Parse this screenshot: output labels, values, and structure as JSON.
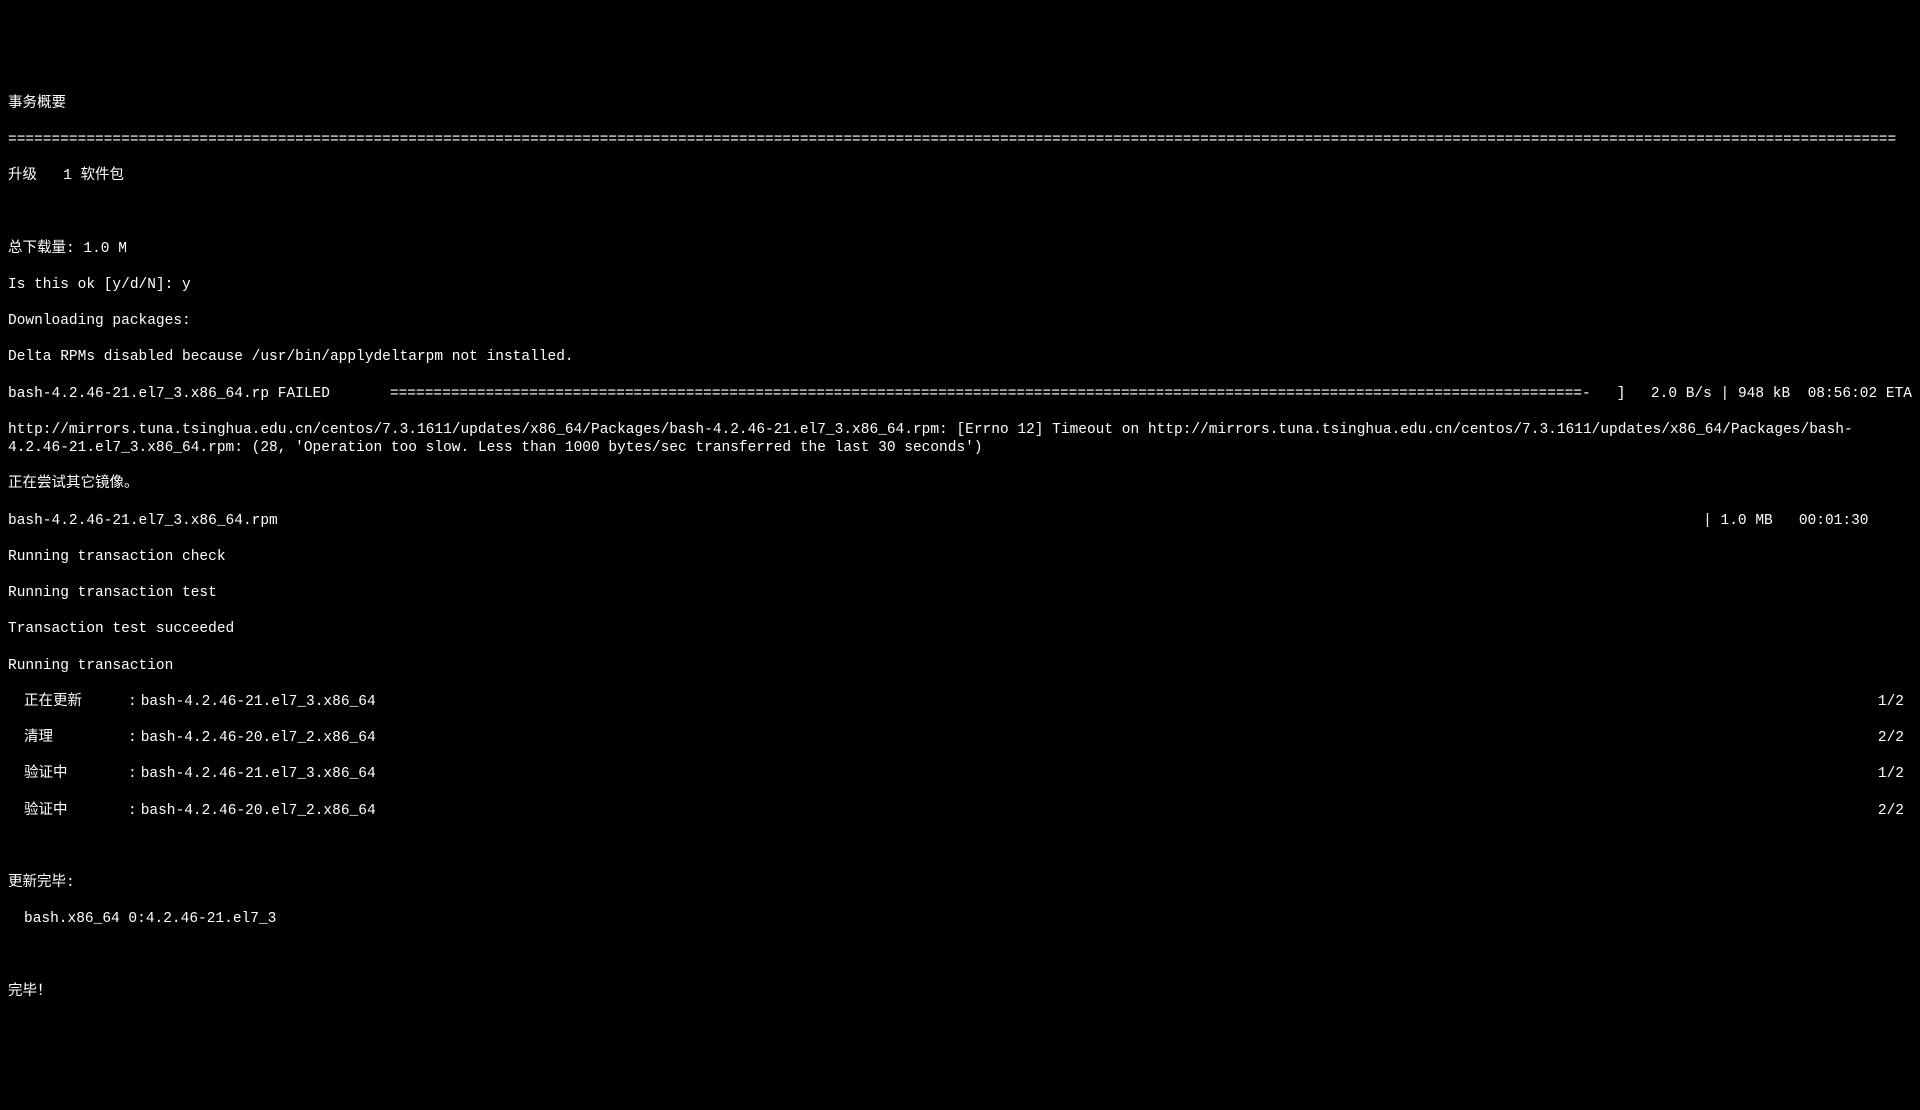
{
  "header": {
    "transaction_summary": "事务概要",
    "rule": "=========================================================================================================================================================================================================================",
    "upgrade_label": "升级",
    "upgrade_count": "1 软件包"
  },
  "download": {
    "total_size_label": "总下载量:",
    "total_size_value": "1.0 M",
    "confirm_prompt": "Is this ok [y/d/N]:",
    "confirm_answer": "y",
    "downloading_packages": "Downloading packages:",
    "delta_rpms": "Delta RPMs disabled because /usr/bin/applydeltarpm not installed."
  },
  "progress": {
    "failed_pkg": "bash-4.2.46-21.el7_3.x86_64.rp FAILED",
    "bar": "=========================================================================================================================================-   ]",
    "speed": "2.0 B/s",
    "size": "948 kB",
    "eta": "08:56:02 ETA"
  },
  "error": {
    "line1": "http://mirrors.tuna.tsinghua.edu.cn/centos/7.3.1611/updates/x86_64/Packages/bash-4.2.46-21.el7_3.x86_64.rpm: [Errno 12] Timeout on http://mirrors.tuna.tsinghua.edu.cn/centos/7.3.1611/updates/x86_64/Packages/bash-4.2.46-21.el7_3.x86_64.rpm: (28, 'Operation too slow. Less than 1000 bytes/sec transferred the last 30 seconds')",
    "trying_mirror": "正在尝试其它镜像。"
  },
  "download2": {
    "pkg": "bash-4.2.46-21.el7_3.x86_64.rpm",
    "size": "1.0 MB",
    "time": "00:01:30"
  },
  "transaction": {
    "check": "Running transaction check",
    "test": "Running transaction test",
    "test_ok": "Transaction test succeeded",
    "running": "Running transaction",
    "steps": [
      {
        "label": "正在更新",
        "pkg": "bash-4.2.46-21.el7_3.x86_64",
        "count": "1/2"
      },
      {
        "label": "清理",
        "pkg": "bash-4.2.46-20.el7_2.x86_64",
        "count": "2/2"
      },
      {
        "label": "验证中",
        "pkg": "bash-4.2.46-21.el7_3.x86_64",
        "count": "1/2"
      },
      {
        "label": "验证中",
        "pkg": "bash-4.2.46-20.el7_2.x86_64",
        "count": "2/2"
      }
    ]
  },
  "result": {
    "updated_label": "更新完毕:",
    "updated_pkg": "bash.x86_64 0:4.2.46-21.el7_3",
    "done": "完毕！"
  }
}
